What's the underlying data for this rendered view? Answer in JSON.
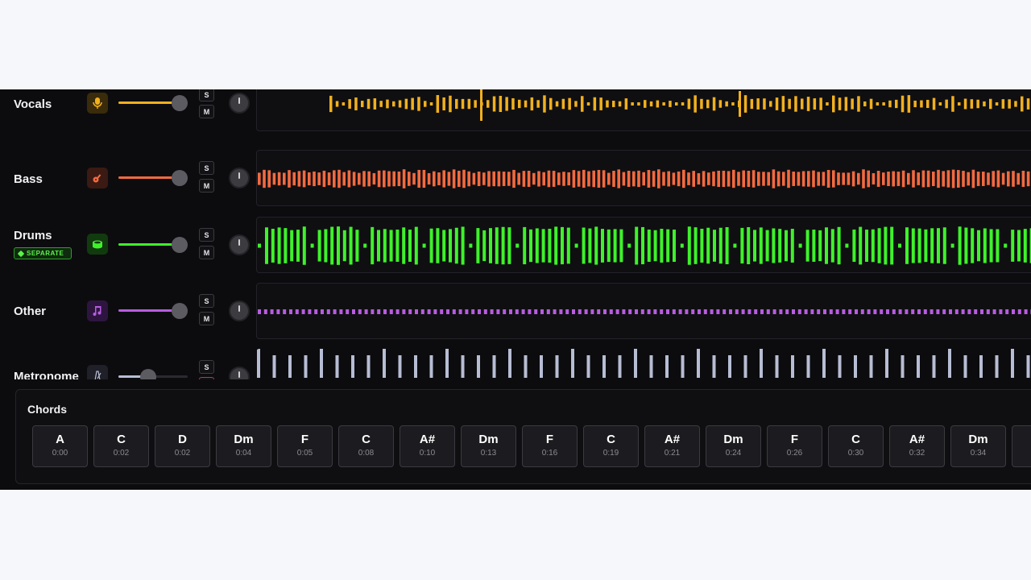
{
  "tracks": [
    {
      "id": "vocals",
      "name": "Vocals",
      "icon": "microphone-icon",
      "color": "#f2b01e",
      "icon_bg": "#3a2b0a",
      "volume": 0.78,
      "solo": "S",
      "mute": "M",
      "badge": null
    },
    {
      "id": "bass",
      "name": "Bass",
      "icon": "guitar-icon",
      "color": "#f26a40",
      "icon_bg": "#3a1a12",
      "volume": 0.78,
      "solo": "S",
      "mute": "M",
      "badge": null
    },
    {
      "id": "drums",
      "name": "Drums",
      "icon": "drum-icon",
      "color": "#3ef22a",
      "icon_bg": "#123a0f",
      "volume": 0.78,
      "solo": "S",
      "mute": "M",
      "badge": "SEPARATE"
    },
    {
      "id": "other",
      "name": "Other",
      "icon": "music-note-icon",
      "color": "#b85ce0",
      "icon_bg": "#2e1540",
      "volume": 0.78,
      "solo": "S",
      "mute": "M",
      "badge": null
    },
    {
      "id": "metronome",
      "name": "Metronome",
      "icon": "metronome-icon",
      "color": "#b7bdd3",
      "icon_bg": "#1f2028",
      "volume": 0.35,
      "solo": "S",
      "mute": "",
      "badge": null
    }
  ],
  "chords": {
    "title": "Chords",
    "items": [
      {
        "name": "A",
        "time": "0:00"
      },
      {
        "name": "C",
        "time": "0:02"
      },
      {
        "name": "D",
        "time": "0:02"
      },
      {
        "name": "Dm",
        "time": "0:04"
      },
      {
        "name": "F",
        "time": "0:05"
      },
      {
        "name": "C",
        "time": "0:08"
      },
      {
        "name": "A#",
        "time": "0:10"
      },
      {
        "name": "Dm",
        "time": "0:13"
      },
      {
        "name": "F",
        "time": "0:16"
      },
      {
        "name": "C",
        "time": "0:19"
      },
      {
        "name": "A#",
        "time": "0:21"
      },
      {
        "name": "Dm",
        "time": "0:24"
      },
      {
        "name": "F",
        "time": "0:26"
      },
      {
        "name": "C",
        "time": "0:30"
      },
      {
        "name": "A#",
        "time": "0:32"
      },
      {
        "name": "Dm",
        "time": "0:34"
      }
    ]
  }
}
